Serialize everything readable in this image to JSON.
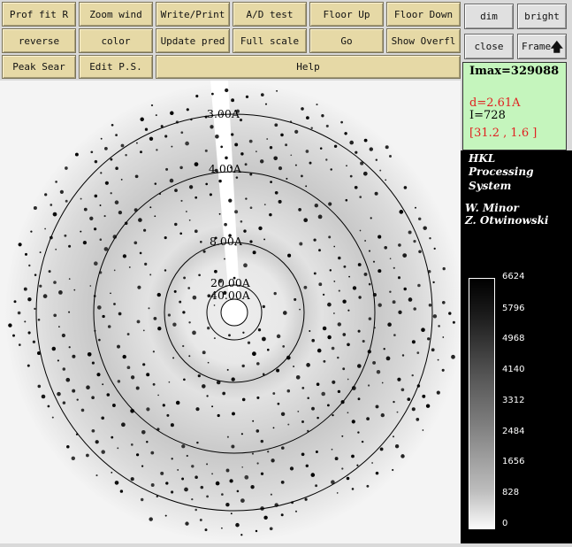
{
  "toolbar": {
    "row1": [
      "Prof fit R",
      "Zoom wind",
      "Write/Print",
      "A/D test",
      "Floor Up",
      "Floor Down"
    ],
    "row2": [
      "reverse",
      "color",
      "Update pred",
      "Full scale",
      "Go",
      "Show Overfl"
    ],
    "row3": [
      "Peak Sear",
      "Edit P.S.",
      "Help"
    ]
  },
  "side_buttons": {
    "dim": "dim",
    "bright": "bright",
    "close": "close",
    "frame": "Frame"
  },
  "info": {
    "imax": "Imax=329088",
    "d_spacing": "d=2.61A",
    "intensity": "I=728",
    "coords": "[31.2 , 1.6 ]"
  },
  "credits": {
    "line1": "HKL",
    "line2": "Processing",
    "line3": "System",
    "line4": "W. Minor",
    "line5": "Z. Otwinowski"
  },
  "scale_labels": [
    "6624",
    "5796",
    "4968",
    "4140",
    "3312",
    "2484",
    "1656",
    "828",
    "0"
  ],
  "resolution_rings": [
    {
      "label": "3.00A"
    },
    {
      "label": "4.00A"
    },
    {
      "label": "8.00A"
    },
    {
      "label": "20.00A"
    },
    {
      "label": "40.00A"
    }
  ],
  "colors": {
    "button_face": "#e6d9a6",
    "info_background": "#c5f5bd",
    "d_spacing_text": "#e02020",
    "coords_text": "#e02020"
  }
}
